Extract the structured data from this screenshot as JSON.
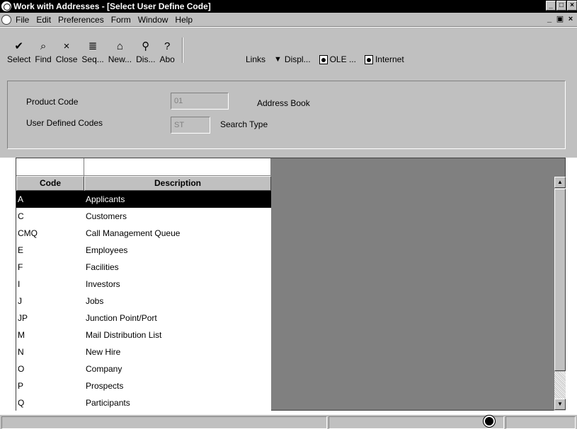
{
  "window": {
    "title": "Work with Addresses - [Select User Define Code]"
  },
  "menu": {
    "items": [
      {
        "label": "File"
      },
      {
        "label": "Edit"
      },
      {
        "label": "Preferences"
      },
      {
        "label": "Form"
      },
      {
        "label": "Window"
      },
      {
        "label": "Help"
      }
    ]
  },
  "toolbar": {
    "buttons": [
      {
        "label": "Select",
        "icon": "checkmark-icon"
      },
      {
        "label": "Find",
        "icon": "find-icon"
      },
      {
        "label": "Close",
        "icon": "close-icon"
      },
      {
        "label": "Seq...",
        "icon": "sequence-icon"
      },
      {
        "label": "New...",
        "icon": "new-icon"
      },
      {
        "label": "Dis...",
        "icon": "display-icon"
      },
      {
        "label": "Abo",
        "icon": "about-icon"
      }
    ],
    "links": {
      "links_label": "Links",
      "display_label": "Displ...",
      "ole_label": "OLE ...",
      "internet_label": "Internet"
    }
  },
  "form": {
    "product_code": {
      "label": "Product Code",
      "value": "01",
      "description": "Address Book"
    },
    "user_defined_codes": {
      "label": "User Defined Codes",
      "value": "ST",
      "description": "Search Type"
    }
  },
  "grid": {
    "columns": [
      "Code",
      "Description"
    ],
    "rows": [
      {
        "code": "A",
        "description": "Applicants",
        "selected": true
      },
      {
        "code": "C",
        "description": "Customers"
      },
      {
        "code": "CMQ",
        "description": "Call Management Queue"
      },
      {
        "code": "E",
        "description": "Employees"
      },
      {
        "code": "F",
        "description": "Facilities"
      },
      {
        "code": "I",
        "description": "Investors"
      },
      {
        "code": "J",
        "description": "Jobs"
      },
      {
        "code": "JP",
        "description": "Junction Point/Port"
      },
      {
        "code": "M",
        "description": "Mail Distribution List"
      },
      {
        "code": "N",
        "description": "New Hire"
      },
      {
        "code": "O",
        "description": "Company"
      },
      {
        "code": "P",
        "description": "Prospects"
      },
      {
        "code": "Q",
        "description": "Participants"
      }
    ]
  },
  "colors": {
    "chrome": "#c0c0c0",
    "grid_background": "#808080",
    "selection": "#000000"
  }
}
